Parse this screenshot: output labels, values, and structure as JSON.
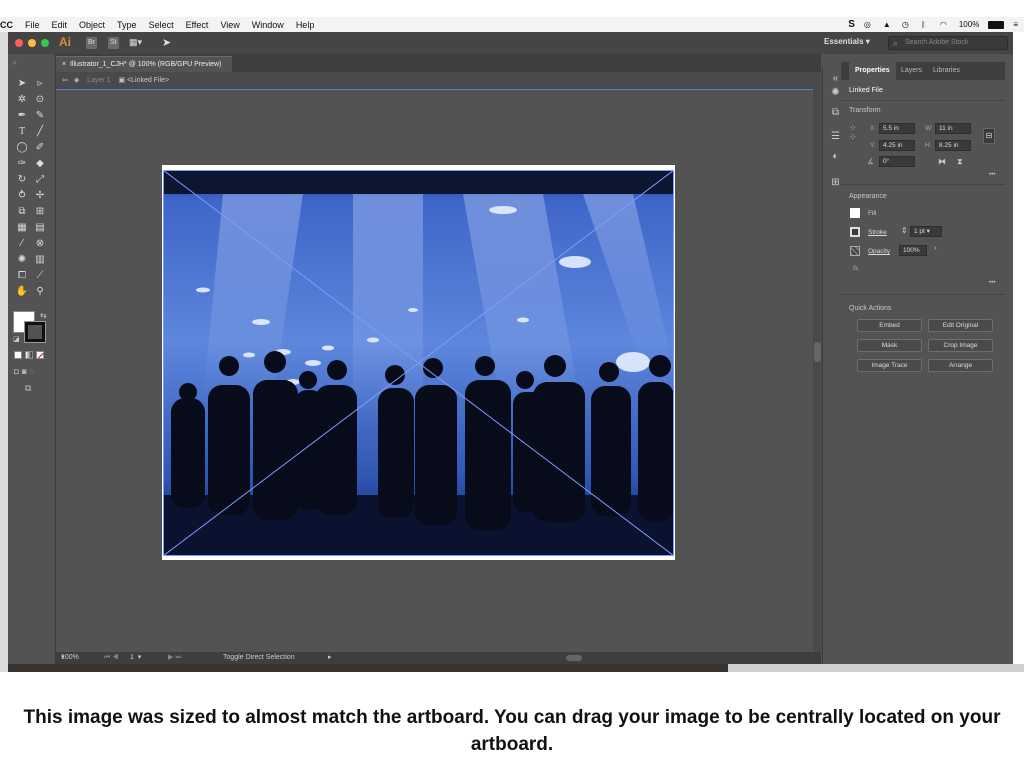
{
  "menubar": {
    "app": "CC",
    "items": [
      "File",
      "Edit",
      "Object",
      "Type",
      "Select",
      "Effect",
      "View",
      "Window",
      "Help"
    ],
    "battery": "100%"
  },
  "app_bar": {
    "logo": "Ai",
    "chips": [
      "Br",
      "St"
    ],
    "workspace": "Essentials",
    "stock_search_placeholder": "Search Adobe Stock"
  },
  "document": {
    "tab_title": "Illustrator_1_CJH* @ 100% (RGB/GPU Preview)",
    "close_glyph": "×",
    "breadcrumb_layer": "Layer 1",
    "breadcrumb_item": "<Linked File>"
  },
  "statusbar": {
    "zoom": "100%",
    "artboard_number": "1",
    "tool_hint": "Toggle Direct Selection"
  },
  "properties": {
    "tabs": [
      "Properties",
      "Layers",
      "Libraries"
    ],
    "object_type": "Linked File",
    "transform_title": "Transform",
    "x_label": "X:",
    "x": "5.5 in",
    "y_label": "Y:",
    "y": "4.25 in",
    "w_label": "W:",
    "w": "11 in",
    "h_label": "H:",
    "h": "8.25 in",
    "rotate": "0°",
    "appearance_title": "Appearance",
    "fill_label": "Fill",
    "stroke_label": "Stroke",
    "stroke_weight": "1 pt",
    "opacity_label": "Opacity",
    "opacity": "100%",
    "fx_label": "fx.",
    "quick_actions_title": "Quick Actions",
    "quick_actions": [
      "Embed",
      "Edit Original",
      "Mask",
      "Crop Image",
      "Image Trace",
      "Arrange"
    ],
    "more_glyph": "•••"
  },
  "caption": "This image was sized to almost match the artboard. You can drag your image to be centrally located on your artboard.",
  "colors": {
    "ui_bg": "#535353",
    "ui_dark": "#3e3e3e",
    "selection_blue": "#5a7bd6",
    "aquarium_top": "#4f77d4",
    "aquarium_bottom": "#0e1f55"
  }
}
